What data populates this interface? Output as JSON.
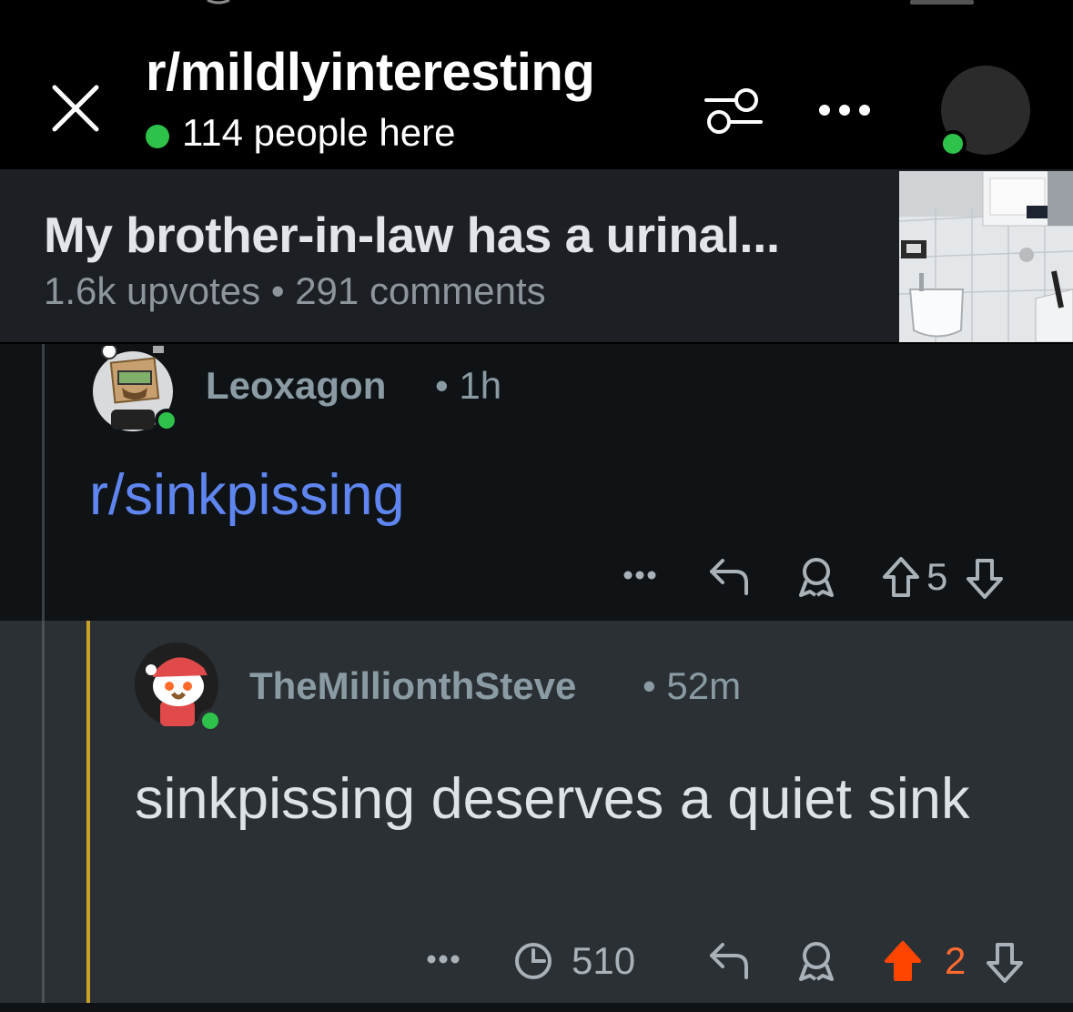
{
  "header": {
    "subreddit": "r/mildlyinteresting",
    "online_count": "114 people here"
  },
  "post": {
    "title": "My brother-in-law has a urinal...",
    "meta": "1.6k upvotes • 291 comments"
  },
  "comments": [
    {
      "author": "Leoxagon",
      "time": "• 1h",
      "body": "r/sinkpissing",
      "vote_count": "5"
    },
    {
      "author": "TheMillionthSteve",
      "time": "• 52m",
      "body": "sinkpissing deserves a quiet sink",
      "views": "510",
      "vote_count": "2"
    }
  ],
  "colors": {
    "online_green": "#2ec24b",
    "link_blue": "#5f86f0",
    "upvoted_orange": "#ff4500",
    "highlight_gold": "#c9a227"
  },
  "icons": [
    "close-icon",
    "filter-icon",
    "more-icon",
    "reply-icon",
    "award-icon",
    "upvote-icon",
    "downvote-icon",
    "views-icon"
  ]
}
